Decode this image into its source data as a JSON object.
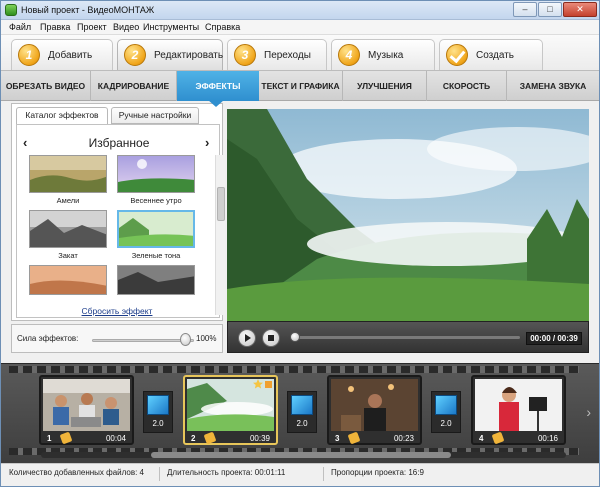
{
  "window": {
    "title": "Новый проект - ВидеоМОНТАЖ",
    "minimize": "–",
    "maximize": "□",
    "close": "✕"
  },
  "menu": [
    "Файл",
    "Правка",
    "Проект",
    "Видео",
    "Инструменты",
    "Справка"
  ],
  "steps": [
    {
      "num": "1",
      "label": "Добавить"
    },
    {
      "num": "2",
      "label": "Редактировать",
      "active": true
    },
    {
      "num": "3",
      "label": "Переходы"
    },
    {
      "num": "4",
      "label": "Музыка"
    },
    {
      "num": "",
      "label": "Создать"
    }
  ],
  "tabs": [
    "ОБРЕЗАТЬ ВИДЕО",
    "КАДРИРОВАНИЕ",
    "ЭФФЕКТЫ",
    "ТЕКСТ И ГРАФИКА",
    "УЛУЧШЕНИЯ",
    "СКОРОСТЬ",
    "ЗАМЕНА ЗВУКА"
  ],
  "active_tab": "ЭФФЕКТЫ",
  "effects": {
    "subtabs": [
      "Каталог эффектов",
      "Ручные настройки"
    ],
    "category": "Избранное",
    "prev": "‹",
    "next": "›",
    "items": [
      {
        "label": "Амели",
        "selected": false
      },
      {
        "label": "Весеннее утро",
        "selected": false
      },
      {
        "label": "Закат",
        "selected": false
      },
      {
        "label": "Зеленые тона",
        "selected": true
      }
    ],
    "reset": "Сбросить эффект"
  },
  "strength": {
    "label": "Сила эффектов:",
    "value": "100%",
    "level": 1.0
  },
  "player": {
    "time": "00:00 / 00:39",
    "progress": 0.0
  },
  "timeline": {
    "clips": [
      {
        "num": "1",
        "duration": "00:04",
        "selected": false
      },
      {
        "num": "2",
        "duration": "00:39",
        "selected": true
      },
      {
        "num": "3",
        "duration": "00:23",
        "selected": false
      },
      {
        "num": "4",
        "duration": "00:16",
        "selected": false
      }
    ],
    "transitions": [
      "2.0",
      "2.0",
      "2.0"
    ]
  },
  "status": {
    "files": "Количество добавленных файлов: 4",
    "duration": "Длительность проекта: 00:01:11",
    "ratio": "Пропорции проекта: 16:9"
  },
  "colors": {
    "accent": "#2f8fcf",
    "step_badge": "#f0a51a",
    "selected_clip": "#e8c65a"
  }
}
